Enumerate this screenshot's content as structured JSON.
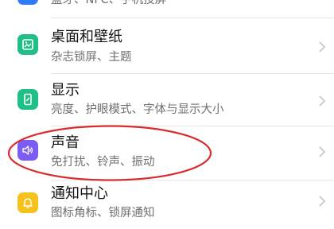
{
  "colors": {
    "text_primary": "#111111",
    "text_secondary": "#6f6f6f",
    "wallpaper_tile": "#1fbf86",
    "display_tile": "#1fbf86",
    "sound_tile": "#7c5cf2",
    "notify_tile": "#f4c21a",
    "top_tile": "#2f7df6",
    "annotation": "#d92b2b"
  },
  "settings": {
    "top_partial": {
      "subtitle": "蓝牙、NFC、手机投屏",
      "icon": "connection-icon"
    },
    "items": [
      {
        "title": "桌面和壁纸",
        "subtitle": "杂志锁屏、主题",
        "icon": "wallpaper-icon"
      },
      {
        "title": "显示",
        "subtitle": "亮度、护眼模式、字体与显示大小",
        "icon": "display-icon"
      },
      {
        "title": "声音",
        "subtitle": "免打扰、铃声、振动",
        "icon": "sound-icon",
        "highlighted": true
      },
      {
        "title": "通知中心",
        "subtitle": "图标角标、锁屏通知",
        "icon": "bell-icon"
      }
    ]
  }
}
